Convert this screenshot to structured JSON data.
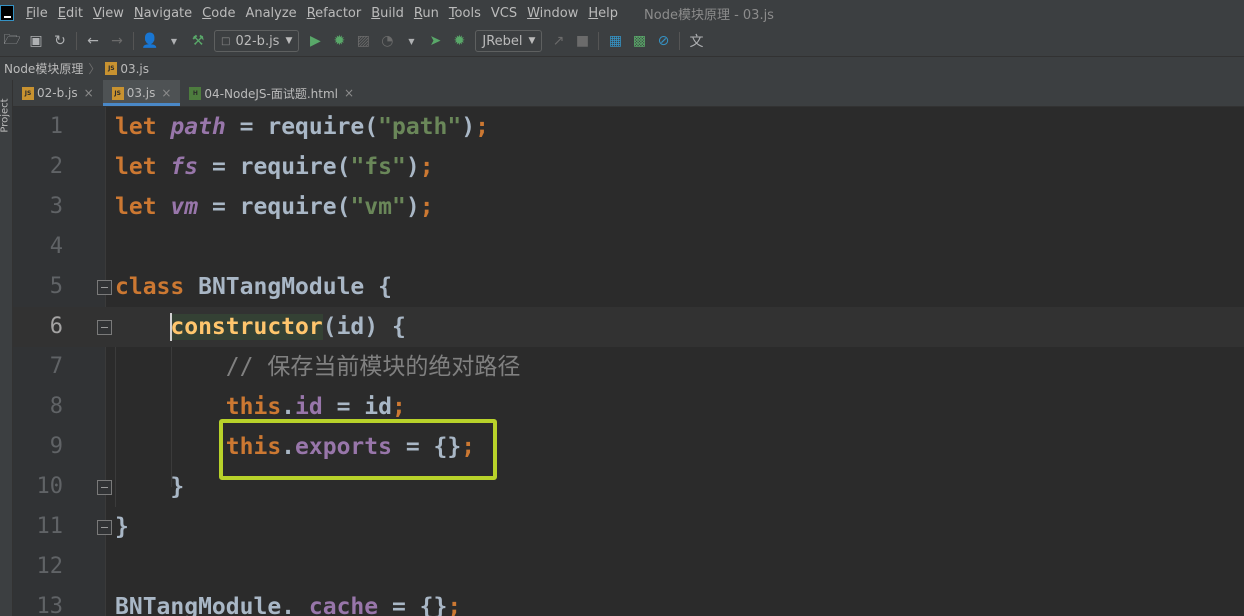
{
  "menubar": {
    "items": [
      {
        "mn": "F",
        "rest": "ile"
      },
      {
        "mn": "E",
        "rest": "dit"
      },
      {
        "mn": "V",
        "rest": "iew"
      },
      {
        "mn": "N",
        "rest": "avigate"
      },
      {
        "mn": "C",
        "rest": "ode"
      },
      {
        "mn": "",
        "rest": "Analyze"
      },
      {
        "mn": "R",
        "rest": "efactor"
      },
      {
        "mn": "B",
        "rest": "uild"
      },
      {
        "mn": "R",
        "rest": "un"
      },
      {
        "mn": "T",
        "rest": "ools"
      },
      {
        "mn": "",
        "rest": "VCS"
      },
      {
        "mn": "W",
        "rest": "indow"
      },
      {
        "mn": "H",
        "rest": "elp"
      }
    ],
    "window_title": "Node模块原理 - 03.js"
  },
  "toolbar": {
    "run_config": "02-b.js",
    "jrebel": "JRebel"
  },
  "breadcrumb": {
    "project": "Node模块原理",
    "file": "03.js"
  },
  "sidebar": {
    "label": "Project"
  },
  "tabs": [
    {
      "label": "02-b.js",
      "type": "JS"
    },
    {
      "label": "03.js",
      "type": "JS"
    },
    {
      "label": "04-NodeJS-面试题.html",
      "type": "H"
    }
  ],
  "editor": {
    "lines": [
      {
        "n": "1"
      },
      {
        "n": "2"
      },
      {
        "n": "3"
      },
      {
        "n": "4"
      },
      {
        "n": "5"
      },
      {
        "n": "6"
      },
      {
        "n": "7"
      },
      {
        "n": "8"
      },
      {
        "n": "9"
      },
      {
        "n": "10"
      },
      {
        "n": "11"
      },
      {
        "n": "12"
      },
      {
        "n": "13"
      }
    ],
    "tokens": {
      "let": "let",
      "path": "path",
      "fs": "fs",
      "vm": "vm",
      "require": "require",
      "str_path": "\"path\"",
      "str_fs": "\"fs\"",
      "str_vm": "\"vm\"",
      "class": "class",
      "class_name": "BNTangModule",
      "constructor": "constructor",
      "param": "(id) {",
      "comment": "// 保存当前模块的绝对路径",
      "this": "this",
      "id_prop": "id",
      "exports_prop": "exports",
      "cache_prop": "_cache"
    }
  },
  "colors": {
    "highlight_box": "#b8d22a",
    "keyword": "#cc7832",
    "string": "#6a8759",
    "variable": "#9876aa"
  }
}
